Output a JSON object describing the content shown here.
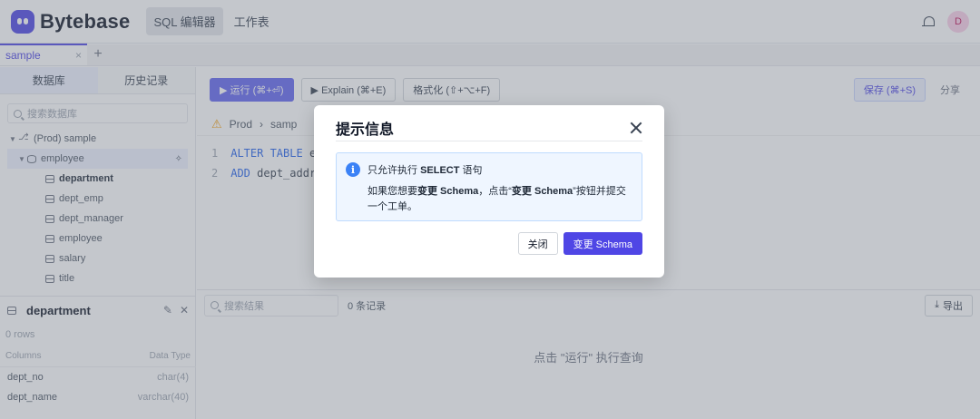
{
  "header": {
    "logo": "Bytebase",
    "nav": [
      "SQL 编辑器",
      "工作表"
    ],
    "avatar": "D"
  },
  "tabs": [
    {
      "label": "sample",
      "close": "×"
    }
  ],
  "tab_add": "+",
  "sidebar": {
    "tabs": [
      "数据库",
      "历史记录"
    ],
    "search_placeholder": "搜索数据库",
    "tree": {
      "env_db": "(Prod) sample",
      "schema": "employee",
      "tables": [
        "department",
        "dept_emp",
        "dept_manager",
        "employee",
        "salary",
        "title"
      ]
    },
    "detail": {
      "title": "department",
      "rows": "0 rows",
      "columns_label": "Columns",
      "type_label": "Data Type",
      "columns": [
        {
          "name": "dept_no",
          "type": "char(4)"
        },
        {
          "name": "dept_name",
          "type": "varchar(40)"
        }
      ]
    }
  },
  "toolbar": {
    "run": "▶ 运行 (⌘+⏎)",
    "explain": "▶ Explain (⌘+E)",
    "format": "格式化 (⇧+⌥+F)",
    "save": "保存 (⌘+S)",
    "share": "分享"
  },
  "breadcrumb": {
    "env": "Prod",
    "db": "samp"
  },
  "editor": {
    "lines": [
      {
        "num": "1",
        "kw": "ALTER TABLE",
        "rest": " e"
      },
      {
        "num": "2",
        "kw": "ADD",
        "rest": " dept_addr"
      }
    ]
  },
  "results": {
    "search_placeholder": "搜索结果",
    "record_count": "0 条记录",
    "export": "导出",
    "empty_hint": "点击 \"运行\" 执行查询"
  },
  "modal": {
    "title": "提示信息",
    "info_icon": "i",
    "info_pre": "只允许执行 ",
    "info_bold": "SELECT",
    "info_post": " 语句",
    "desc_1": "如果您想要",
    "desc_bold_1": "变更 Schema",
    "desc_2": "，点击“",
    "desc_bold_2": "变更 Schema",
    "desc_3": "”按钮并提交一个工单。",
    "cancel": "关闭",
    "confirm": "变更 Schema"
  },
  "colors": {
    "accent": "#4f46e5",
    "info_bg": "#eff6ff",
    "info_icon": "#3b82f6",
    "warn": "#f59e0b"
  }
}
